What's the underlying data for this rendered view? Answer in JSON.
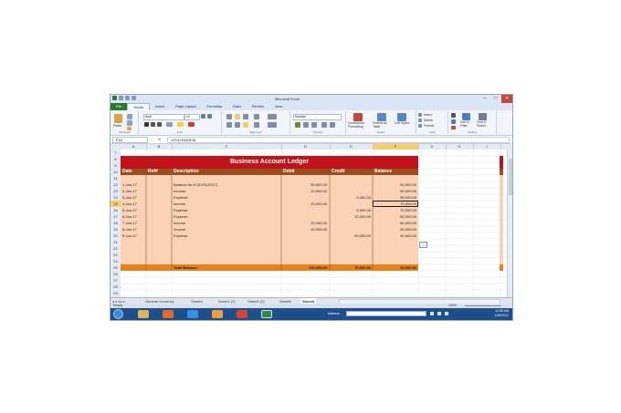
{
  "window": {
    "title": "Microsoft Excel",
    "controls": [
      "–",
      "□",
      "✕"
    ]
  },
  "ribbon_tabs": [
    "File",
    "Home",
    "Insert",
    "Page Layout",
    "Formulas",
    "Data",
    "Review",
    "View"
  ],
  "ribbon": {
    "groups": [
      "Clipboard",
      "Font",
      "Alignment",
      "Number",
      "Styles",
      "Cells",
      "Editing"
    ],
    "paste_label": "Paste",
    "font_name": "Arial",
    "font_size": "10",
    "number_format": "Number",
    "conditional_formatting": "Conditional Formatting",
    "format_as_table": "Format as Table",
    "cell_styles": "Cell Styles",
    "insert": "Insert",
    "delete": "Delete",
    "format": "Format",
    "sort_filter": "Sort & Filter",
    "find_select": "Find & Select"
  },
  "formula_bar": {
    "name_box": "F15",
    "fx": "fx",
    "formula": "=F14+D15-E15"
  },
  "columns": [
    "A",
    "B",
    "C",
    "D",
    "E",
    "F",
    "G",
    "H",
    "I"
  ],
  "rows": [
    "7",
    "8",
    "9",
    "10",
    "11",
    "12",
    "13",
    "14",
    "15",
    "16",
    "17",
    "18",
    "19",
    "20",
    "21",
    "22",
    "23",
    "24",
    "25",
    "26",
    "27",
    "28",
    "29"
  ],
  "ledger": {
    "title": "Business Account Ledger",
    "headers": [
      "Date",
      "Ref#",
      "Description",
      "Debit",
      "Credit",
      "Balance"
    ],
    "entries": [
      {
        "date": "1-Jan-17",
        "desc": "Balance As of (01/01/2017)",
        "debit": "50,000.00",
        "credit": "",
        "balance": "50,000.00"
      },
      {
        "date": "2-Jan-17",
        "desc": "Income",
        "debit": "10,000.00",
        "credit": "",
        "balance": "60,000.00"
      },
      {
        "date": "3-Jan-17",
        "desc": "Expense",
        "debit": "",
        "credit": "5,000.00",
        "balance": "55,000.00"
      },
      {
        "date": "4-Jan-17",
        "desc": "Income",
        "debit": "20,000.00",
        "credit": "",
        "balance": "75,000.00"
      },
      {
        "date": "5-Jan-17",
        "desc": "Expense",
        "debit": "",
        "credit": "5,000.00",
        "balance": "70,000.00"
      },
      {
        "date": "6-Jan-17",
        "desc": "Expense",
        "debit": "",
        "credit": "10,000.00",
        "balance": "60,000.00"
      },
      {
        "date": "7-Jan-17",
        "desc": "Income",
        "debit": "20,000.00",
        "credit": "",
        "balance": "80,000.00"
      },
      {
        "date": "8-Jan-17",
        "desc": "Income",
        "debit": "10,000.00",
        "credit": "",
        "balance": "90,000.00"
      },
      {
        "date": "9-Jan-17",
        "desc": "Expense",
        "debit": "",
        "credit": "50,000.00",
        "balance": "40,000.00"
      }
    ],
    "total_label": "Total Balance",
    "total_debit": "110,000.00",
    "total_credit": "70,000.00",
    "total_balance": "40,000.00"
  },
  "sheet_tabs": [
    "General Currency",
    "Sheet4",
    "Sheet1 (2)",
    "Sheet5 (2)",
    "Sheet6",
    "Sheet3"
  ],
  "active_sheet": "Sheet3",
  "status": {
    "ready": "Ready",
    "zoom": "100%"
  },
  "taskbar": {
    "address_label": "Address",
    "time": "12:55 AM",
    "date": "1/26/2017"
  },
  "colors": {
    "title_red": "#c0141a",
    "header_brown": "#9a4e1e",
    "body_peach": "#fbd3b4",
    "total_orange": "#e8811a",
    "accent_bar": "#d06612",
    "ribbon_bg": "#f1f5fa",
    "taskbar": "#1d4f8a"
  }
}
